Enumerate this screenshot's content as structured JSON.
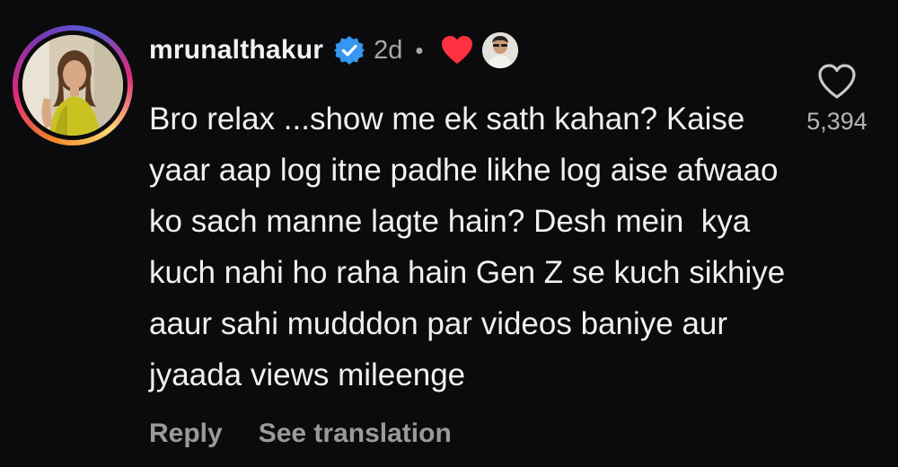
{
  "comment": {
    "username": "mrunalthakur",
    "time_ago": "2d",
    "separator": "•",
    "text_lines": [
      "Bro relax ...show me ek sath kahan? Kaise",
      "yaar aap log itne padhe likhe log aise afwaao",
      "ko sach manne lagte hain? Desh mein  kya",
      "kuch nahi ho raha hain Gen Z se kuch sikhiye",
      "aaur sahi mudddon par videos baniye aur",
      "jyaada views mileenge"
    ],
    "actions": {
      "reply": "Reply",
      "translate": "See translation"
    },
    "likes": "5,394"
  },
  "icons": {
    "verified": "verified-badge-icon",
    "author_like": "heart-filled-icon",
    "like": "heart-outline-icon"
  },
  "colors": {
    "background": "#0b0b0d",
    "verified_blue": "#3797f0",
    "heart_red": "#ff3040",
    "muted_text": "#a8a8a8"
  }
}
